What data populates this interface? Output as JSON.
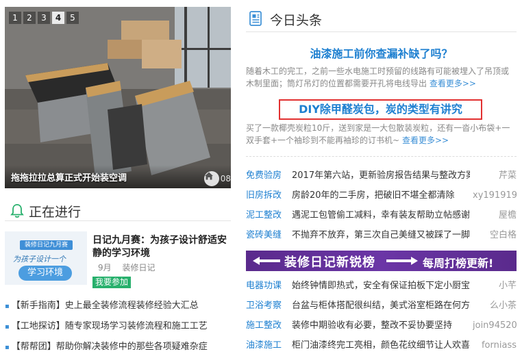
{
  "slider": {
    "pages": [
      "1",
      "2",
      "3",
      "4",
      "5"
    ],
    "active_page": "4",
    "caption": "拖拖拉拉总算正式开始装空调",
    "watermark": "08",
    "watermark_icon": "home-icon"
  },
  "in_progress": {
    "title": "正在进行",
    "icon": "bell-icon",
    "event": {
      "thumb_badge": "装修日记九月赛",
      "thumb_line1": "为孩子设计一个",
      "thumb_line2": "学习环境",
      "title": "日记九月赛：为孩子设计舒适安静的学习环境",
      "month": "9月",
      "category": "装修日记",
      "join_label": "我要参加"
    },
    "links": [
      "【新手指南】史上最全装修流程装修经验大汇总",
      "【工地探访】随专家现场学习装修流程和施工工艺",
      "【帮帮团】帮助你解决装修中的那些各项疑难杂症"
    ]
  },
  "headlines": {
    "title": "今日头条",
    "icon": "news-icon",
    "item1": {
      "title": "油漆施工前你查漏补缺了吗？",
      "desc": "随着木工的完工，之前一些水电施工时预留的线路有可能被埋入了吊顶或木制里面；筒灯吊灯的位置都需要开孔将电线导出",
      "more": "查看更多>>"
    },
    "item2": {
      "title": "DIY除甲醛炭包，炭的类型有讲究",
      "desc": "买了一款椰壳炭粒10斤，送到家是一大包散装炭粒，还有一沓小布袋+一双手套+一个袖珍到不能再袖珍的订书机~",
      "more": "查看更多>>"
    },
    "rows_top": [
      {
        "cat": "免费验房",
        "text": "2017年第六站，更新验房报告结果与整改方案",
        "user": "芹菜"
      },
      {
        "cat": "旧房拆改",
        "text": "房龄20年的二手房，把破旧不堪全都清除",
        "user": "xy191919"
      },
      {
        "cat": "泥工整改",
        "text": "遇泥工包管偷工减料，幸有装友帮助立帖感谢",
        "user": "屋檐"
      },
      {
        "cat": "瓷砖美缝",
        "text": "不抛弃不放弃，第三次自己美缝又被踩了一脚",
        "user": "空白格"
      }
    ],
    "banner": {
      "left": "装修日记新锐榜",
      "right": "每周打榜更新!"
    },
    "rows_bottom": [
      {
        "cat": "电器功课",
        "text": "始终钟情即热式，安全有保证拍板下定小厨宝",
        "user": "小芊"
      },
      {
        "cat": "卫浴考察",
        "text": "台盆与柜体搭配很纠结，美式浴室柜路在何方",
        "user": "么小茶"
      },
      {
        "cat": "施工整改",
        "text": "装修中期验收有必要，整改不妥协要坚持",
        "user": "join94520"
      },
      {
        "cat": "油漆施工",
        "text": "柜门油漆终完工亮相，颜色花纹细节让人欢喜",
        "user": "forniass"
      }
    ]
  }
}
